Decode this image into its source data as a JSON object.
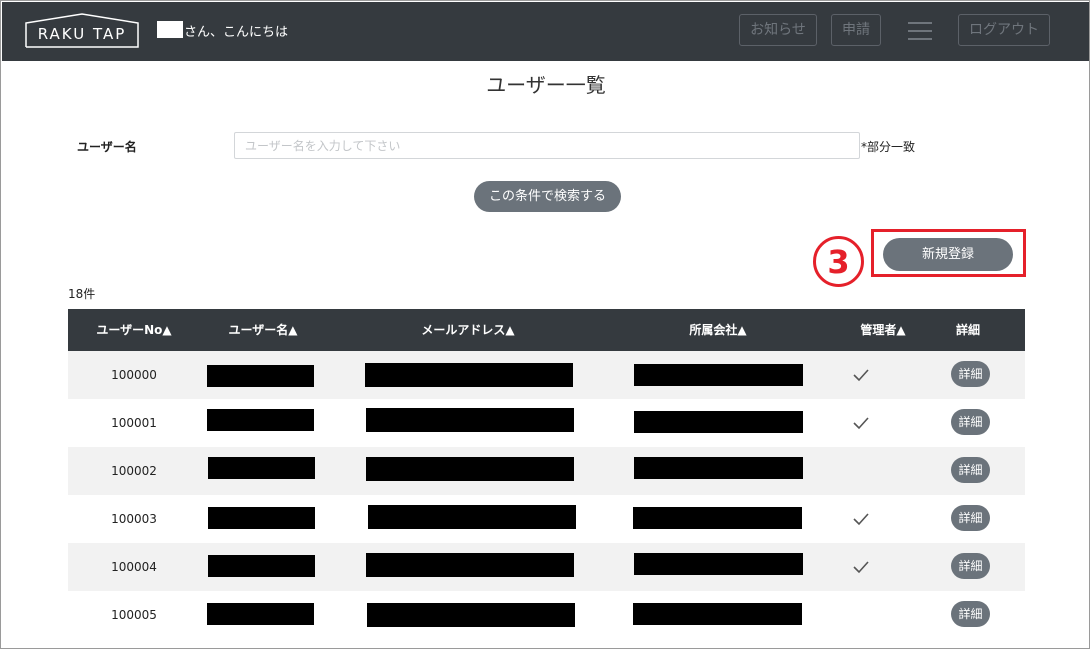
{
  "header": {
    "logo_text": "RAKU TAP",
    "greeting": "さん、こんにちは",
    "notice_label": "お知らせ",
    "apply_label": "申請",
    "logout_label": "ログアウト"
  },
  "page": {
    "title": "ユーザー一覧"
  },
  "search": {
    "label": "ユーザー名",
    "placeholder": "ユーザー名を入力して下さい",
    "value": "",
    "match_note": "*部分一致",
    "button_label": "この条件で検索する"
  },
  "callout": {
    "number": "3",
    "color": "#e5202a"
  },
  "register_button_label": "新規登録",
  "result_count": "18件",
  "table": {
    "columns": [
      "ユーザーNo▲",
      "ユーザー名▲",
      "メールアドレス▲",
      "所属会社▲",
      "管理者▲",
      "詳細"
    ],
    "detail_label": "詳細",
    "rows": [
      {
        "no": "100000",
        "admin": true
      },
      {
        "no": "100001",
        "admin": true
      },
      {
        "no": "100002",
        "admin": false
      },
      {
        "no": "100003",
        "admin": true
      },
      {
        "no": "100004",
        "admin": true
      },
      {
        "no": "100005",
        "admin": false
      }
    ]
  },
  "colors": {
    "header_bg": "#353a3f",
    "button_bg": "#6b737b",
    "row_alt_bg": "#f2f2f2"
  }
}
